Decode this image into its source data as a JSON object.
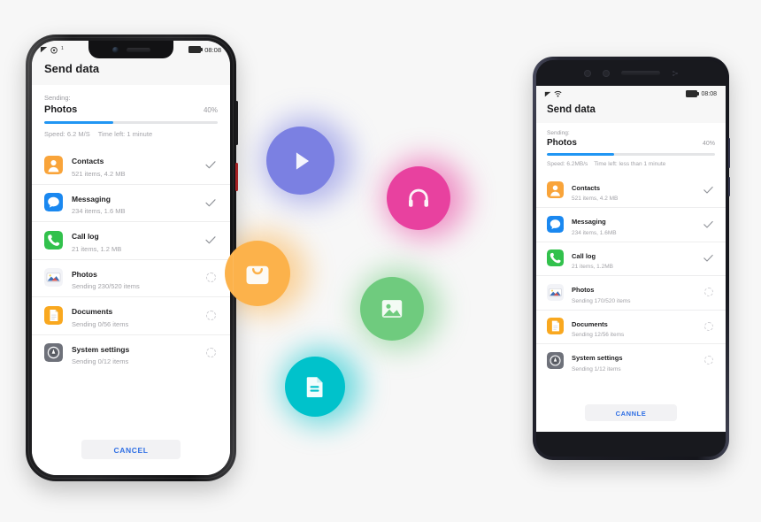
{
  "colors": {
    "background": "#f7f7f7",
    "accent_blue": "#2196f3",
    "cancel_text": "#2f6fe4",
    "bubble_play": "#7b80e2",
    "bubble_headphones": "#e8419f",
    "bubble_image": "#6fcb7e",
    "bubble_document": "#00c2cb",
    "bubble_apps": "#fcb24b",
    "icon_contacts": "#f9a43a",
    "icon_messaging": "#1a88f0",
    "icon_calllog": "#32c14c",
    "icon_photos": "#f2f3f7",
    "icon_documents": "#f9a81f",
    "icon_settings": "#6e717a",
    "title_text": "#1c1c1e",
    "muted_text": "#a3a3a8",
    "divider": "#ededee"
  },
  "bubbles": [
    {
      "name": "video-bubble",
      "icon": "play-icon",
      "color": "#7b80e2"
    },
    {
      "name": "audio-bubble",
      "icon": "headphones-icon",
      "color": "#e8419f"
    },
    {
      "name": "gallery-bubble",
      "icon": "image-icon",
      "color": "#6fcb7e"
    },
    {
      "name": "documents-bubble",
      "icon": "document-icon",
      "color": "#00c2cb"
    },
    {
      "name": "apps-bubble",
      "icon": "app-bag-icon",
      "color": "#fcb24b"
    }
  ],
  "phone_left": {
    "device": "notch-phone",
    "status_bar": {
      "signal_icon": "signal-bars-icon",
      "network_icon": "network-icon",
      "network_sup": "1",
      "battery_icon": "battery-icon",
      "time": "08:08"
    },
    "app_title": "Send data",
    "progress": {
      "sending_label": "Sending:",
      "current_item": "Photos",
      "percent_label": "40%",
      "percent_value": 40,
      "speed": "Speed: 6.2 M/S",
      "time_left": "Time left: 1 minute"
    },
    "items": [
      {
        "icon": "contacts-icon",
        "name": "Contacts",
        "detail": "521 items, 4.2 MB",
        "status": "done"
      },
      {
        "icon": "messaging-icon",
        "name": "Messaging",
        "detail": "234 items, 1.6 MB",
        "status": "done"
      },
      {
        "icon": "call-log-icon",
        "name": "Call log",
        "detail": "21 items, 1.2 MB",
        "status": "done"
      },
      {
        "icon": "photos-icon",
        "name": "Photos",
        "detail": "Sending 230/520 items",
        "status": "pending"
      },
      {
        "icon": "documents-icon",
        "name": "Documents",
        "detail": "Sending 0/56 items",
        "status": "pending"
      },
      {
        "icon": "system-settings-icon",
        "name": "System settings",
        "detail": "Sending 0/12 items",
        "status": "pending"
      }
    ],
    "cancel_label": "CANCEL"
  },
  "phone_right": {
    "device": "bezel-phone",
    "status_bar": {
      "signal_icon": "signal-bars-icon",
      "network_icon": "network-icon",
      "battery_icon": "battery-icon",
      "time": "08:08"
    },
    "app_title": "Send data",
    "progress": {
      "sending_label": "Sending:",
      "current_item": "Photos",
      "percent_label": "40%",
      "percent_value": 40,
      "speed": "Speed: 6.2MB/s",
      "time_left": "Time left: less than 1 minute"
    },
    "items": [
      {
        "icon": "contacts-icon",
        "name": "Contacts",
        "detail": "521 items, 4.2 MB",
        "status": "done"
      },
      {
        "icon": "messaging-icon",
        "name": "Messaging",
        "detail": "234 items, 1.6MB",
        "status": "done"
      },
      {
        "icon": "call-log-icon",
        "name": "Call log",
        "detail": "21 items, 1.2MB",
        "status": "done"
      },
      {
        "icon": "photos-icon",
        "name": "Photos",
        "detail": "Sending 170/520 items",
        "status": "pending"
      },
      {
        "icon": "documents-icon",
        "name": "Documents",
        "detail": "Sending 12/56 items",
        "status": "pending"
      },
      {
        "icon": "system-settings-icon",
        "name": "System settings",
        "detail": "Sending 1/12 items",
        "status": "pending"
      }
    ],
    "cancel_label": "CANNLE"
  }
}
